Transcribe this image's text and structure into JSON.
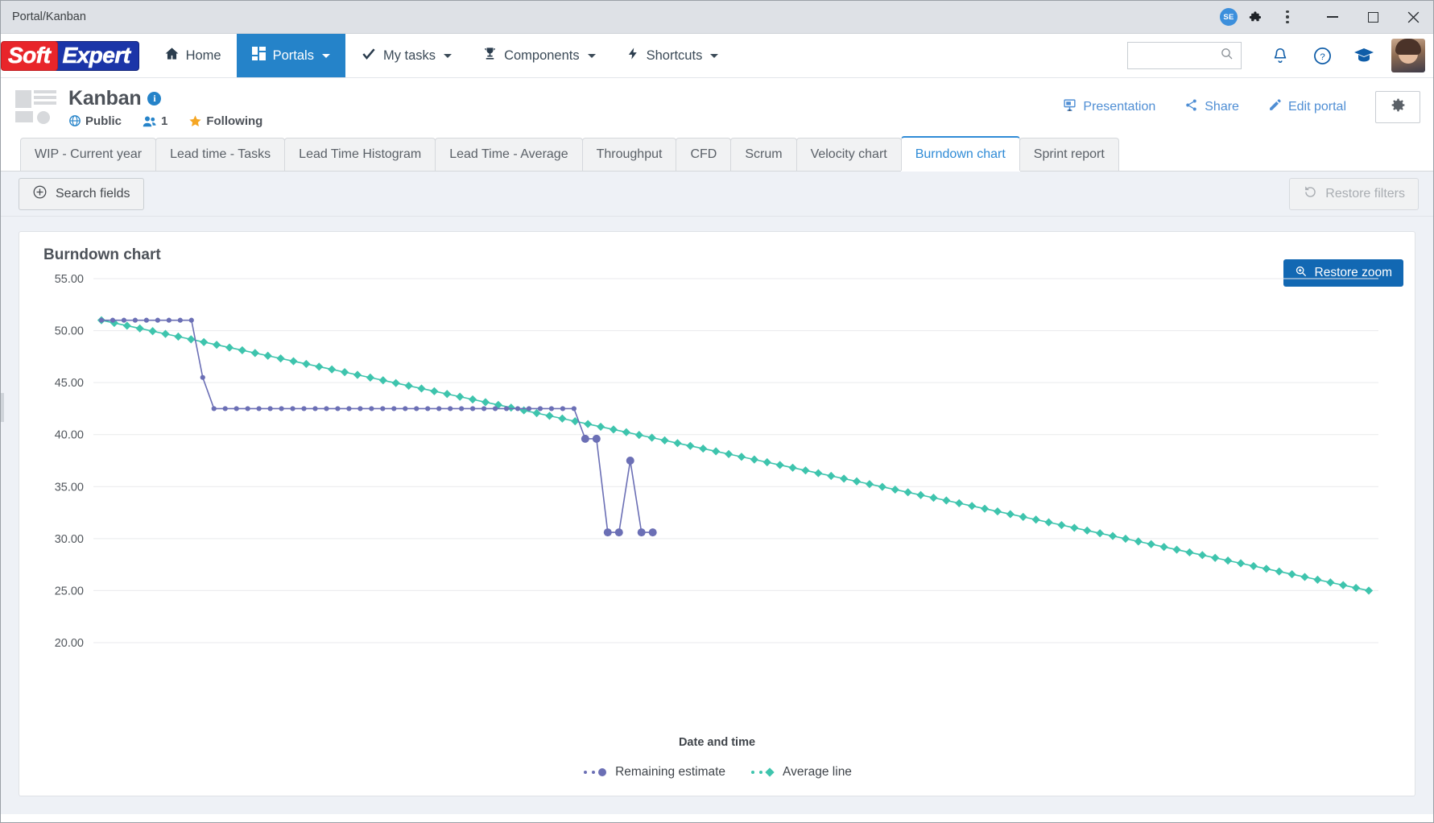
{
  "browser": {
    "tab_title": "Portal/Kanban",
    "profile_badge": "SE",
    "icons": [
      "extensions-puzzle-icon",
      "kebab-menu-icon",
      "minimize-icon",
      "maximize-icon",
      "close-icon"
    ]
  },
  "appbar": {
    "logo": {
      "part1": "Soft",
      "part2": "Expert"
    },
    "nav": [
      {
        "label": "Home",
        "icon": "home-icon",
        "active": false,
        "caret": false
      },
      {
        "label": "Portals",
        "icon": "portals-grid-icon",
        "active": true,
        "caret": true
      },
      {
        "label": "My tasks",
        "icon": "check-icon",
        "active": false,
        "caret": true
      },
      {
        "label": "Components",
        "icon": "trophy-icon",
        "active": false,
        "caret": true
      },
      {
        "label": "Shortcuts",
        "icon": "lightning-icon",
        "active": false,
        "caret": true
      }
    ],
    "search_placeholder": "",
    "search_value": "",
    "right_icons": [
      "search-icon",
      "bell-icon",
      "help-icon",
      "academy-icon",
      "avatar"
    ]
  },
  "portal": {
    "title": "Kanban",
    "info_icon": "info-icon",
    "visibility": "Public",
    "members_count": "1",
    "following": "Following",
    "actions": [
      {
        "label": "Presentation",
        "icon": "presentation-icon"
      },
      {
        "label": "Share",
        "icon": "share-icon"
      },
      {
        "label": "Edit portal",
        "icon": "pencil-icon"
      }
    ],
    "settings_icon": "gear-icon"
  },
  "tabs": [
    {
      "label": "WIP - Current year",
      "active": false
    },
    {
      "label": "Lead time - Tasks",
      "active": false
    },
    {
      "label": "Lead Time Histogram",
      "active": false
    },
    {
      "label": "Lead Time - Average",
      "active": false
    },
    {
      "label": "Throughput",
      "active": false
    },
    {
      "label": "CFD",
      "active": false
    },
    {
      "label": "Scrum",
      "active": false
    },
    {
      "label": "Velocity chart",
      "active": false
    },
    {
      "label": "Burndown chart",
      "active": true
    },
    {
      "label": "Sprint report",
      "active": false
    }
  ],
  "filterbar": {
    "search_fields_label": "Search fields",
    "search_fields_icon": "plus-circle-icon",
    "restore_filters_label": "Restore filters",
    "restore_filters_icon": "restore-icon",
    "restore_filters_disabled": true
  },
  "card": {
    "title": "Burndown chart",
    "restore_zoom_label": "Restore zoom",
    "restore_zoom_icon": "zoom-search-icon",
    "restore_zoom_color": "#1268b3"
  },
  "chart_data": {
    "type": "line",
    "title": "Burndown chart",
    "xlabel": "Date and time",
    "ylabel": "",
    "ylim": [
      20,
      55
    ],
    "yticks": [
      "20.00",
      "25.00",
      "30.00",
      "35.00",
      "40.00",
      "45.00",
      "50.00",
      "55.00"
    ],
    "ytick_values": [
      20,
      25,
      30,
      35,
      40,
      45,
      50,
      55
    ],
    "xticks": [],
    "grid": true,
    "legend_position": "bottom",
    "series": [
      {
        "name": "Remaining estimate",
        "color": "#6b6fb5",
        "marker": "circle",
        "x": [
          0,
          1,
          2,
          3,
          4,
          5,
          6,
          7,
          8,
          9,
          10,
          11,
          12,
          13,
          14,
          15,
          16,
          17,
          18,
          19,
          20,
          21,
          22,
          23,
          24,
          25,
          26,
          27,
          28,
          29,
          30,
          31,
          32,
          33,
          34,
          35,
          36,
          37,
          38,
          39,
          40,
          41,
          42,
          43,
          44,
          45,
          46,
          47,
          48,
          49
        ],
        "values": [
          51,
          51,
          51,
          51,
          51,
          51,
          51,
          51,
          51,
          45.5,
          42.5,
          42.5,
          42.5,
          42.5,
          42.5,
          42.5,
          42.5,
          42.5,
          42.5,
          42.5,
          42.5,
          42.5,
          42.5,
          42.5,
          42.5,
          42.5,
          42.5,
          42.5,
          42.5,
          42.5,
          42.5,
          42.5,
          42.5,
          42.5,
          42.5,
          42.5,
          42.5,
          42.5,
          42.5,
          42.5,
          42.5,
          42.5,
          42.5,
          39.6,
          39.6,
          30.6,
          30.6,
          37.5,
          30.6,
          30.6
        ]
      },
      {
        "name": "Average line",
        "color": "#3ec4ad",
        "marker": "diamond",
        "x": [
          0,
          1,
          2,
          3,
          4,
          5,
          6,
          7,
          8,
          9,
          10,
          11,
          12,
          13,
          14,
          15,
          16,
          17,
          18,
          19,
          20,
          21,
          22,
          23,
          24,
          25,
          26,
          27,
          28,
          29,
          30,
          31,
          32,
          33,
          34,
          35,
          36,
          37,
          38,
          39,
          40,
          41,
          42,
          43,
          44,
          45,
          46,
          47,
          48,
          49,
          50,
          51,
          52,
          53,
          54,
          55,
          56,
          57,
          58,
          59,
          60,
          61,
          62,
          63,
          64,
          65,
          66,
          67,
          68,
          69,
          70,
          71,
          72,
          73,
          74,
          75,
          76,
          77,
          78,
          79,
          80,
          81,
          82,
          83,
          84,
          85,
          86,
          87,
          88,
          89,
          90,
          91,
          92,
          93,
          94,
          95,
          96,
          97,
          98,
          99
        ],
        "start_value": 51.0,
        "end_value": 25.0
      }
    ],
    "legend": [
      {
        "label": "Remaining estimate",
        "color": "#6b6fb5",
        "marker": "circle"
      },
      {
        "label": "Average line",
        "color": "#3ec4ad",
        "marker": "diamond"
      }
    ]
  }
}
